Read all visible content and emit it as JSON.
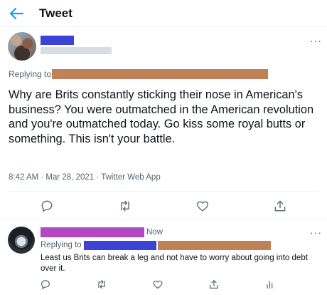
{
  "header": {
    "title": "Tweet"
  },
  "main_tweet": {
    "replying_to": "Replying to",
    "text": "Why are Brits constantly sticking their nose in American's business?  You were outmatched in the American revolution and you're outmatched today. Go kiss some royal butts or something. This isn't your battle.",
    "meta": "8:42 AM · Mar 28, 2021 · Twitter Web App",
    "more": "···"
  },
  "reply_tweet": {
    "time": "Now",
    "replying_to": "Replying to",
    "text": "Least us Brits can break a leg and not have to worry about going into debt over it.",
    "more": "···"
  },
  "icons": [
    "back-arrow-icon",
    "reply-icon",
    "retweet-icon",
    "like-icon",
    "share-icon",
    "analytics-icon"
  ],
  "colors": {
    "accent": "#1d9bf0",
    "muted": "#536471",
    "redact_blue": "#3a43d6",
    "redact_orange": "#c08058",
    "redact_purple": "#b14ac2"
  }
}
